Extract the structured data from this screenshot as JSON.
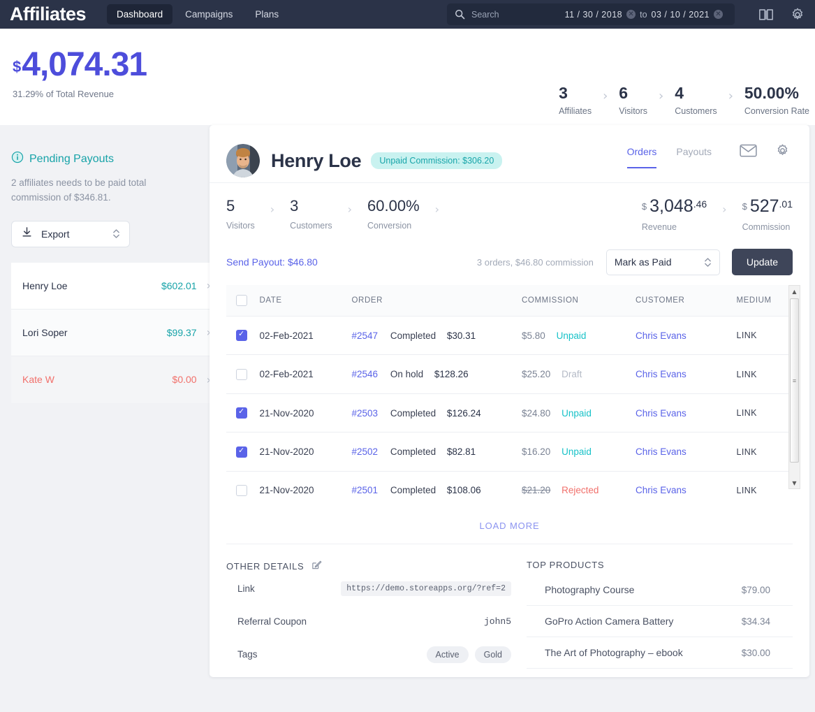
{
  "topbar": {
    "brand": "Affiliates",
    "nav": [
      {
        "label": "Dashboard",
        "active": true
      },
      {
        "label": "Campaigns",
        "active": false
      },
      {
        "label": "Plans",
        "active": false
      }
    ],
    "search": {
      "placeholder": "Search",
      "date_from": "11 / 30 / 2018",
      "to_label": "to",
      "date_to": "03 / 10 / 2021",
      "clear_glyph": "✕"
    },
    "icons": {
      "book": "book-icon",
      "gear": "gear-icon"
    }
  },
  "summary": {
    "currency": "$",
    "revenue": "4,074.31",
    "revenue_sub": "31.29% of Total Revenue",
    "kpis": [
      {
        "value": "3",
        "label": "Affiliates"
      },
      {
        "value": "6",
        "label": "Visitors"
      },
      {
        "value": "4",
        "label": "Customers"
      },
      {
        "value": "50.00%",
        "label": "Conversion Rate"
      }
    ],
    "separator": "›"
  },
  "sidebar": {
    "title": "Pending Payouts",
    "description": "2 affiliates needs to be paid total commission of $346.81.",
    "export_label": "Export",
    "payouts": [
      {
        "name": "Henry Loe",
        "amount": "$602.01",
        "danger": false
      },
      {
        "name": "Lori Soper",
        "amount": "$99.37",
        "danger": false
      },
      {
        "name": "Kate W",
        "amount": "$0.00",
        "danger": true
      }
    ],
    "chevron": "›"
  },
  "card": {
    "affiliate_name": "Henry Loe",
    "badge": "Unpaid Commission: $306.20",
    "tabs": [
      {
        "label": "Orders",
        "active": true
      },
      {
        "label": "Payouts",
        "active": false
      }
    ],
    "icons": {
      "mail": "mail-icon",
      "gear": "gear-icon"
    },
    "stats": [
      {
        "value": "5",
        "label": "Visitors"
      },
      {
        "value": "3",
        "label": "Customers"
      },
      {
        "value": "60.00%",
        "label": "Conversion"
      }
    ],
    "money": [
      {
        "symbol": "$",
        "main": "3,048",
        "cents": ".46",
        "label": "Revenue"
      },
      {
        "symbol": "$",
        "main": "527",
        "cents": ".01",
        "label": "Commission"
      }
    ],
    "separator": "›",
    "payout_action": {
      "send_payout": "Send Payout: $46.80",
      "orders_note": "3 orders, $46.80 commission",
      "select_value": "Mark as Paid",
      "update_label": "Update"
    },
    "table": {
      "headers": [
        "DATE",
        "ORDER",
        "COMMISSION",
        "CUSTOMER",
        "MEDIUM"
      ],
      "rows": [
        {
          "checked": true,
          "date": "02-Feb-2021",
          "order_id": "#2547",
          "order_status": "Completed",
          "order_total": "$30.31",
          "commission": "$5.80",
          "comm_status": "Unpaid",
          "comm_state": "unpaid",
          "customer": "Chris Evans",
          "medium": "LINK"
        },
        {
          "checked": false,
          "date": "02-Feb-2021",
          "order_id": "#2546",
          "order_status": "On hold",
          "order_total": "$128.26",
          "commission": "$25.20",
          "comm_status": "Draft",
          "comm_state": "draft",
          "customer": "Chris Evans",
          "medium": "LINK"
        },
        {
          "checked": true,
          "date": "21-Nov-2020",
          "order_id": "#2503",
          "order_status": "Completed",
          "order_total": "$126.24",
          "commission": "$24.80",
          "comm_status": "Unpaid",
          "comm_state": "unpaid",
          "customer": "Chris Evans",
          "medium": "LINK"
        },
        {
          "checked": true,
          "date": "21-Nov-2020",
          "order_id": "#2502",
          "order_status": "Completed",
          "order_total": "$82.81",
          "commission": "$16.20",
          "comm_status": "Unpaid",
          "comm_state": "unpaid",
          "customer": "Chris Evans",
          "medium": "LINK"
        },
        {
          "checked": false,
          "date": "21-Nov-2020",
          "order_id": "#2501",
          "order_status": "Completed",
          "order_total": "$108.06",
          "commission": "$21.20",
          "comm_status": "Rejected",
          "comm_state": "rejected",
          "customer": "Chris Evans",
          "medium": "LINK"
        }
      ],
      "load_more": "LOAD MORE"
    },
    "other_details": {
      "title": "OTHER DETAILS",
      "link_key": "Link",
      "link_value": "https://demo.storeapps.org/?ref=2",
      "coupon_key": "Referral Coupon",
      "coupon_value": "john5",
      "tags_key": "Tags",
      "tags": [
        "Active",
        "Gold"
      ]
    },
    "top_products": {
      "title": "TOP PRODUCTS",
      "items": [
        {
          "name": "Photography Course",
          "price": "$79.00"
        },
        {
          "name": "GoPro Action Camera Battery",
          "price": "$34.34"
        },
        {
          "name": "The Art of Photography – ebook",
          "price": "$30.00"
        }
      ]
    }
  },
  "colors": {
    "topbar": "#2b3348",
    "accent_purple": "#5a63e8",
    "accent_teal": "#17a3a8",
    "danger": "#f1706b"
  }
}
